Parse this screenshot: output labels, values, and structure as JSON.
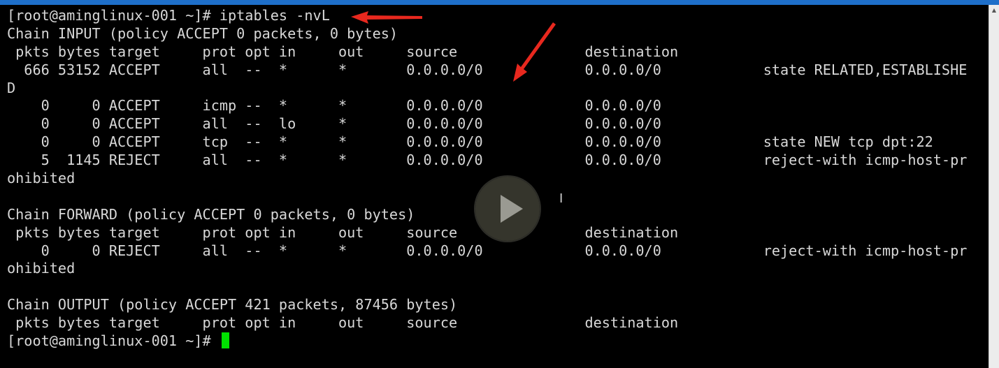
{
  "colors": {
    "background": "#000000",
    "text": "#d8d8d8",
    "cursor": "#00e000",
    "annotation_arrow": "#e8281e"
  },
  "icons": {
    "play": "play-icon",
    "text_cursor": "i-beam-cursor-icon",
    "arrow": "red-arrow-annotation"
  },
  "terminal": {
    "lines": [
      "[root@aminglinux-001 ~]# iptables -nvL",
      "Chain INPUT (policy ACCEPT 0 packets, 0 bytes)",
      " pkts bytes target     prot opt in     out     source               destination",
      "  666 53152 ACCEPT     all  --  *      *       0.0.0.0/0            0.0.0.0/0            state RELATED,ESTABLISHE",
      "D",
      "    0     0 ACCEPT     icmp --  *      *       0.0.0.0/0            0.0.0.0/0",
      "    0     0 ACCEPT     all  --  lo     *       0.0.0.0/0            0.0.0.0/0",
      "    0     0 ACCEPT     tcp  --  *      *       0.0.0.0/0            0.0.0.0/0            state NEW tcp dpt:22",
      "    5  1145 REJECT     all  --  *      *       0.0.0.0/0            0.0.0.0/0            reject-with icmp-host-pr",
      "ohibited",
      "",
      "Chain FORWARD (policy ACCEPT 0 packets, 0 bytes)",
      " pkts bytes target     prot opt in     out     source               destination",
      "    0     0 REJECT     all  --  *      *       0.0.0.0/0            0.0.0.0/0            reject-with icmp-host-pr",
      "ohibited",
      "",
      "Chain OUTPUT (policy ACCEPT 421 packets, 87456 bytes)",
      " pkts bytes target     prot opt in     out     source               destination"
    ],
    "prompt": "[root@aminglinux-001 ~]# "
  }
}
